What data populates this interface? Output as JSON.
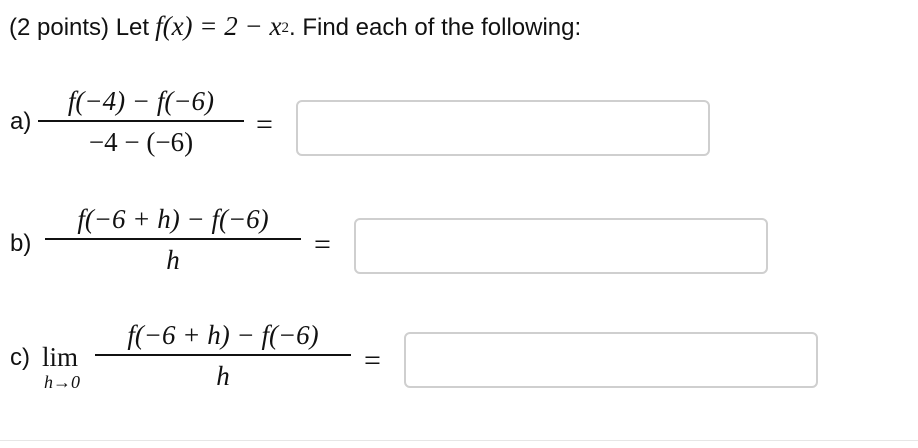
{
  "header": {
    "points": "(2 points) Let",
    "function_expr": "f(x) = 2 − x",
    "exponent": "2",
    "instruction": ". Find each of the following:"
  },
  "parts": [
    {
      "label": "a)",
      "numerator": "f(−4) − f(−6)",
      "denominator": "−4 − (−6)",
      "equals": "=",
      "answer_value": ""
    },
    {
      "label": "b)",
      "numerator": "f(−6 + h) − f(−6)",
      "denominator": "h",
      "equals": "=",
      "answer_value": ""
    },
    {
      "label": "c)",
      "lim_word": "lim",
      "lim_subscript": "h→0",
      "numerator": "f(−6 + h) − f(−6)",
      "denominator": "h",
      "equals": "=",
      "answer_value": ""
    }
  ]
}
